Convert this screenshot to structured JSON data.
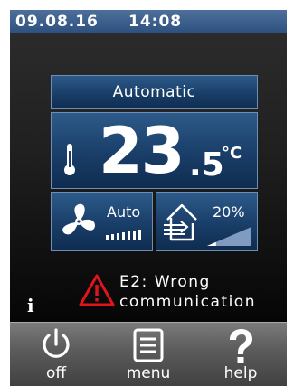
{
  "status": {
    "date": "09.08.16",
    "time": "14:08"
  },
  "mode": {
    "label": "Automatic"
  },
  "temperature": {
    "integer": "23",
    "decimal": ".5",
    "unit": "°C"
  },
  "fan": {
    "label": "Auto",
    "icon": "fan-icon"
  },
  "ventilation": {
    "percent": "20%",
    "level": 0.2,
    "icon": "air-inlet-icon"
  },
  "error": {
    "line1": "E2: Wrong",
    "line2": "communication",
    "icon": "warning-icon",
    "color": "#e0141d"
  },
  "footer": {
    "off_label": "off",
    "menu_label": "menu",
    "help_label": "help"
  },
  "colors": {
    "status_bar": "#3b5f8e",
    "tile": "#1f4a78",
    "tile_border": "#6d8fb7"
  }
}
